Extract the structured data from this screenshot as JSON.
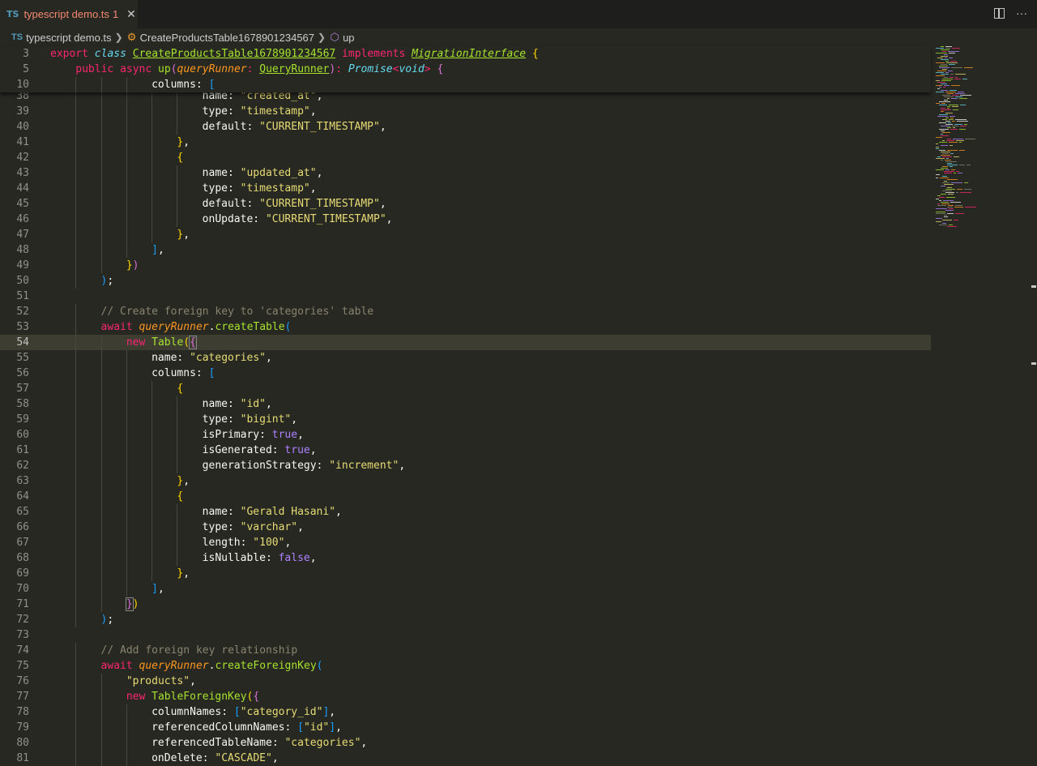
{
  "tab": {
    "lang": "TS",
    "filename": "typescript demo.ts",
    "problems": "1",
    "close": "✕"
  },
  "tab_actions": {
    "more": "···"
  },
  "breadcrumb": {
    "file": "typescript demo.ts",
    "class": "CreateProductsTable1678901234567",
    "method": "up"
  },
  "sticky": [
    {
      "n": "3",
      "indent": 0,
      "tokens": [
        [
          "kw",
          "export "
        ],
        [
          "st",
          "class "
        ],
        [
          "ty",
          "CreateProductsTable1678901234567"
        ],
        [
          "p",
          " "
        ],
        [
          "kw",
          "implements "
        ],
        [
          "tyi",
          "MigrationInterface"
        ],
        [
          "p",
          " "
        ],
        [
          "b1",
          "{"
        ]
      ]
    },
    {
      "n": "5",
      "indent": 1,
      "tokens": [
        [
          "kw",
          "public "
        ],
        [
          "kw",
          "async "
        ],
        [
          "fn",
          "up"
        ],
        [
          "b2",
          "("
        ],
        [
          "pa",
          "queryRunner"
        ],
        [
          "kw",
          ": "
        ],
        [
          "ty",
          "QueryRunner"
        ],
        [
          "b2",
          ")"
        ],
        [
          "kw",
          ": "
        ],
        [
          "st",
          "Promise"
        ],
        [
          "kw",
          "<"
        ],
        [
          "st",
          "void"
        ],
        [
          "kw",
          ">"
        ],
        [
          "p",
          " "
        ],
        [
          "b2",
          "{"
        ]
      ]
    },
    {
      "n": "10",
      "indent": 4,
      "tokens": [
        [
          "p",
          "columns: "
        ],
        [
          "b3",
          "["
        ]
      ]
    }
  ],
  "lines": [
    {
      "n": "38",
      "indent": 6,
      "tokens": [
        [
          "p",
          "name: "
        ],
        [
          "str",
          "\"created_at\""
        ],
        [
          "p",
          ","
        ]
      ]
    },
    {
      "n": "39",
      "indent": 6,
      "tokens": [
        [
          "p",
          "type: "
        ],
        [
          "str",
          "\"timestamp\""
        ],
        [
          "p",
          ","
        ]
      ]
    },
    {
      "n": "40",
      "indent": 6,
      "tokens": [
        [
          "p",
          "default: "
        ],
        [
          "str",
          "\"CURRENT_TIMESTAMP\""
        ],
        [
          "p",
          ","
        ]
      ]
    },
    {
      "n": "41",
      "indent": 5,
      "tokens": [
        [
          "b1",
          "}"
        ],
        [
          "p",
          ","
        ]
      ]
    },
    {
      "n": "42",
      "indent": 5,
      "tokens": [
        [
          "b1",
          "{"
        ]
      ]
    },
    {
      "n": "43",
      "indent": 6,
      "tokens": [
        [
          "p",
          "name: "
        ],
        [
          "str",
          "\"updated_at\""
        ],
        [
          "p",
          ","
        ]
      ]
    },
    {
      "n": "44",
      "indent": 6,
      "tokens": [
        [
          "p",
          "type: "
        ],
        [
          "str",
          "\"timestamp\""
        ],
        [
          "p",
          ","
        ]
      ]
    },
    {
      "n": "45",
      "indent": 6,
      "tokens": [
        [
          "p",
          "default: "
        ],
        [
          "str",
          "\"CURRENT_TIMESTAMP\""
        ],
        [
          "p",
          ","
        ]
      ]
    },
    {
      "n": "46",
      "indent": 6,
      "tokens": [
        [
          "p",
          "onUpdate: "
        ],
        [
          "str",
          "\"CURRENT_TIMESTAMP\""
        ],
        [
          "p",
          ","
        ]
      ]
    },
    {
      "n": "47",
      "indent": 5,
      "tokens": [
        [
          "b1",
          "}"
        ],
        [
          "p",
          ","
        ]
      ]
    },
    {
      "n": "48",
      "indent": 4,
      "tokens": [
        [
          "b3",
          "]"
        ],
        [
          "p",
          ","
        ]
      ]
    },
    {
      "n": "49",
      "indent": 3,
      "tokens": [
        [
          "b1",
          "}"
        ],
        [
          "b2",
          ")"
        ]
      ]
    },
    {
      "n": "50",
      "indent": 2,
      "tokens": [
        [
          "b3",
          ")"
        ],
        [
          "p",
          ";"
        ]
      ]
    },
    {
      "n": "51",
      "indent": 0,
      "tokens": []
    },
    {
      "n": "52",
      "indent": 2,
      "tokens": [
        [
          "cm",
          "// Create foreign key to 'categories' table"
        ]
      ]
    },
    {
      "n": "53",
      "indent": 2,
      "tokens": [
        [
          "kw",
          "await "
        ],
        [
          "pa",
          "queryRunner"
        ],
        [
          "p",
          "."
        ],
        [
          "fn",
          "createTable"
        ],
        [
          "b3",
          "("
        ]
      ]
    },
    {
      "n": "54",
      "indent": 3,
      "current": true,
      "tokens": [
        [
          "kw",
          "new "
        ],
        [
          "fn",
          "Table"
        ],
        [
          "b1",
          "("
        ],
        [
          "b2box",
          "{"
        ]
      ]
    },
    {
      "n": "55",
      "indent": 4,
      "tokens": [
        [
          "p",
          "name: "
        ],
        [
          "str",
          "\"categories\""
        ],
        [
          "p",
          ","
        ]
      ]
    },
    {
      "n": "56",
      "indent": 4,
      "tokens": [
        [
          "p",
          "columns: "
        ],
        [
          "b3",
          "["
        ]
      ]
    },
    {
      "n": "57",
      "indent": 5,
      "tokens": [
        [
          "b1",
          "{"
        ]
      ]
    },
    {
      "n": "58",
      "indent": 6,
      "tokens": [
        [
          "p",
          "name: "
        ],
        [
          "str",
          "\"id\""
        ],
        [
          "p",
          ","
        ]
      ]
    },
    {
      "n": "59",
      "indent": 6,
      "tokens": [
        [
          "p",
          "type: "
        ],
        [
          "str",
          "\"bigint\""
        ],
        [
          "p",
          ","
        ]
      ]
    },
    {
      "n": "60",
      "indent": 6,
      "tokens": [
        [
          "p",
          "isPrimary: "
        ],
        [
          "bool",
          "true"
        ],
        [
          "p",
          ","
        ]
      ]
    },
    {
      "n": "61",
      "indent": 6,
      "tokens": [
        [
          "p",
          "isGenerated: "
        ],
        [
          "bool",
          "true"
        ],
        [
          "p",
          ","
        ]
      ]
    },
    {
      "n": "62",
      "indent": 6,
      "tokens": [
        [
          "p",
          "generationStrategy: "
        ],
        [
          "str",
          "\"increment\""
        ],
        [
          "p",
          ","
        ]
      ]
    },
    {
      "n": "63",
      "indent": 5,
      "tokens": [
        [
          "b1",
          "}"
        ],
        [
          "p",
          ","
        ]
      ]
    },
    {
      "n": "64",
      "indent": 5,
      "tokens": [
        [
          "b1",
          "{"
        ]
      ]
    },
    {
      "n": "65",
      "indent": 6,
      "tokens": [
        [
          "p",
          "name: "
        ],
        [
          "str",
          "\"Gerald Hasani\""
        ],
        [
          "p",
          ","
        ]
      ]
    },
    {
      "n": "66",
      "indent": 6,
      "tokens": [
        [
          "p",
          "type: "
        ],
        [
          "str",
          "\"varchar\""
        ],
        [
          "p",
          ","
        ]
      ]
    },
    {
      "n": "67",
      "indent": 6,
      "tokens": [
        [
          "p",
          "length: "
        ],
        [
          "str",
          "\"100\""
        ],
        [
          "p",
          ","
        ]
      ]
    },
    {
      "n": "68",
      "indent": 6,
      "tokens": [
        [
          "p",
          "isNullable: "
        ],
        [
          "bool",
          "false"
        ],
        [
          "p",
          ","
        ]
      ]
    },
    {
      "n": "69",
      "indent": 5,
      "tokens": [
        [
          "b1",
          "}"
        ],
        [
          "p",
          ","
        ]
      ]
    },
    {
      "n": "70",
      "indent": 4,
      "tokens": [
        [
          "b3",
          "]"
        ],
        [
          "p",
          ","
        ]
      ]
    },
    {
      "n": "71",
      "indent": 3,
      "tokens": [
        [
          "b2box",
          "}"
        ],
        [
          "b1",
          ")"
        ]
      ]
    },
    {
      "n": "72",
      "indent": 2,
      "tokens": [
        [
          "b3",
          ")"
        ],
        [
          "p",
          ";"
        ]
      ]
    },
    {
      "n": "73",
      "indent": 0,
      "tokens": []
    },
    {
      "n": "74",
      "indent": 2,
      "tokens": [
        [
          "cm",
          "// Add foreign key relationship"
        ]
      ]
    },
    {
      "n": "75",
      "indent": 2,
      "tokens": [
        [
          "kw",
          "await "
        ],
        [
          "pa",
          "queryRunner"
        ],
        [
          "p",
          "."
        ],
        [
          "fn",
          "createForeignKey"
        ],
        [
          "b3",
          "("
        ]
      ]
    },
    {
      "n": "76",
      "indent": 3,
      "tokens": [
        [
          "str",
          "\"products\""
        ],
        [
          "p",
          ","
        ]
      ]
    },
    {
      "n": "77",
      "indent": 3,
      "tokens": [
        [
          "kw",
          "new "
        ],
        [
          "fn",
          "TableForeignKey"
        ],
        [
          "b1",
          "("
        ],
        [
          "b2",
          "{"
        ]
      ]
    },
    {
      "n": "78",
      "indent": 4,
      "tokens": [
        [
          "p",
          "columnNames: "
        ],
        [
          "b3",
          "["
        ],
        [
          "str",
          "\"category_id\""
        ],
        [
          "b3",
          "]"
        ],
        [
          "p",
          ","
        ]
      ]
    },
    {
      "n": "79",
      "indent": 4,
      "tokens": [
        [
          "p",
          "referencedColumnNames: "
        ],
        [
          "b3",
          "["
        ],
        [
          "str",
          "\"id\""
        ],
        [
          "b3",
          "]"
        ],
        [
          "p",
          ","
        ]
      ]
    },
    {
      "n": "80",
      "indent": 4,
      "tokens": [
        [
          "p",
          "referencedTableName: "
        ],
        [
          "str",
          "\"categories\""
        ],
        [
          "p",
          ","
        ]
      ]
    },
    {
      "n": "81",
      "indent": 4,
      "tokens": [
        [
          "p",
          "onDelete: "
        ],
        [
          "str",
          "\"CASCADE\""
        ],
        [
          "p",
          ","
        ]
      ]
    }
  ],
  "colors": {
    "background": "#272822",
    "current_line": "#3e3d32",
    "error": "#f48771"
  }
}
